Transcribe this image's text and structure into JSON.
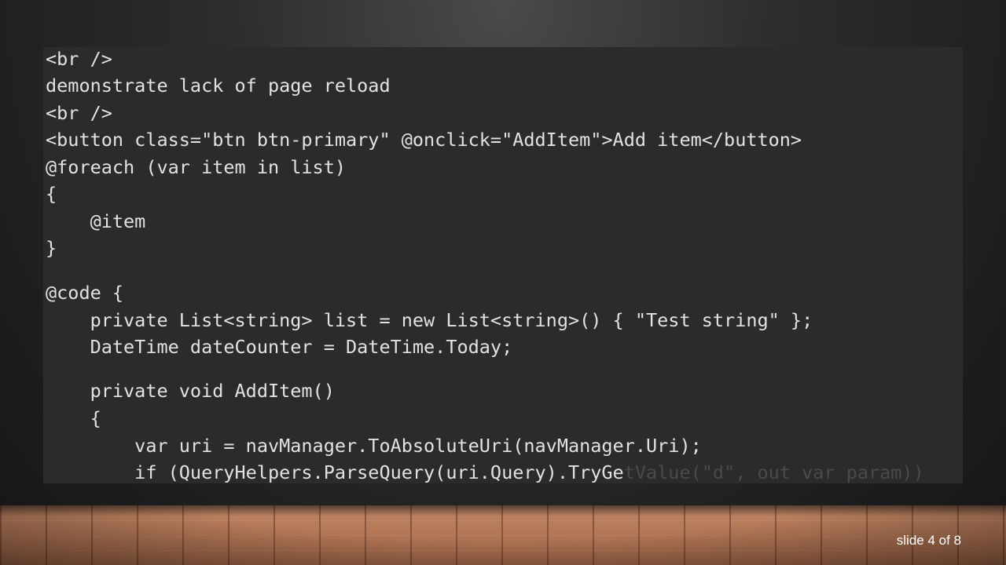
{
  "code_lines": [
    {
      "text": "<br />"
    },
    {
      "text": "demonstrate lack of page reload"
    },
    {
      "text": "<br />"
    },
    {
      "text": "<button class=\"btn btn-primary\" @onclick=\"AddItem\">Add item</button>"
    },
    {
      "text": "@foreach (var item in list)"
    },
    {
      "text": "{"
    },
    {
      "text": "    @item"
    },
    {
      "text": "}"
    },
    {
      "text": "@code {"
    },
    {
      "text": "    private List<string> list = new List<string>() { \"Test string\" };"
    },
    {
      "text": "    DateTime dateCounter = DateTime.Today;"
    },
    {
      "text": "    private void AddItem()"
    },
    {
      "text": "    {"
    },
    {
      "text": "        var uri = navManager.ToAbsoluteUri(navManager.Uri);"
    },
    {
      "text": "        if (QueryHelpers.ParseQuery(uri.Query).TryGe",
      "faded": "tValue(\"d\", out var param))"
    }
  ],
  "slide_counter": "slide 4 of 8"
}
